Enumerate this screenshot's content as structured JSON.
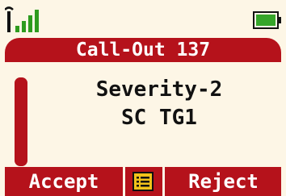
{
  "status_bar": {
    "signal_icon": "signal-strength-full-icon",
    "battery_icon": "battery-full-icon"
  },
  "call": {
    "title": "Call-Out 137",
    "line1": "Severity-2",
    "line2": "SC TG1"
  },
  "softkeys": {
    "left_label": "Accept",
    "center_icon": "menu-list-icon",
    "right_label": "Reject"
  },
  "colors": {
    "accent_red": "#b5121b",
    "background": "#fdf6e6",
    "signal_green": "#2e9b1e",
    "battery_green": "#35a52a"
  },
  "scroll": {
    "position_fraction": 0.0
  }
}
